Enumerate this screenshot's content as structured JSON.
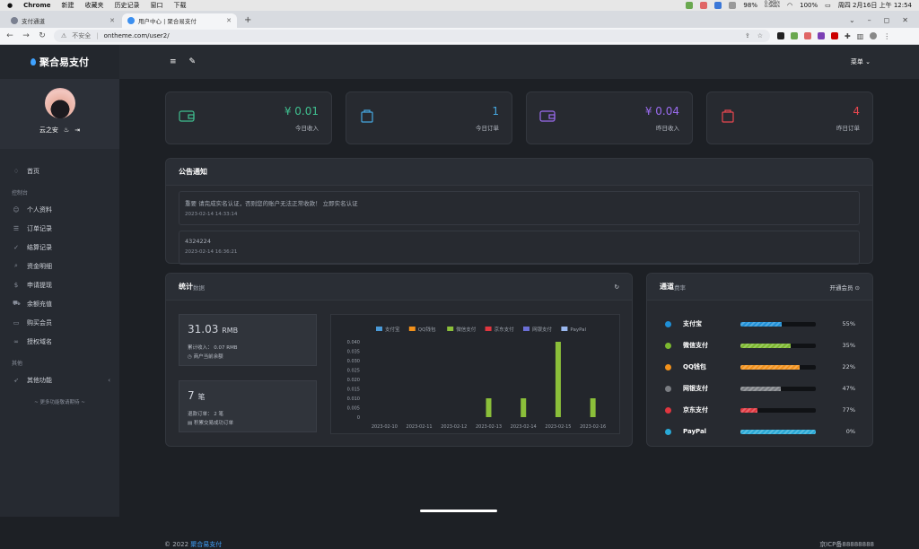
{
  "macbar": {
    "apple": "",
    "items": [
      "Chrome",
      "新建",
      "收藏夹",
      "历史记录",
      "窗口",
      "下载"
    ],
    "battery": "98%",
    "net_up": "0.3KB/s",
    "net_down": "0.5KB/s",
    "zoom": "100%",
    "clock": "周四 2月16日 上午 12:54"
  },
  "tabs": [
    {
      "label": "支付通道"
    },
    {
      "label": "用户中心 | 聚合易支付"
    }
  ],
  "address": {
    "security": "不安全",
    "url": "ontheme.com/user2/"
  },
  "brand": "聚合易支付",
  "user": {
    "name": "云之安"
  },
  "topbar": {
    "menu_label": "菜单"
  },
  "sidebar": {
    "home": "首页",
    "section_console": "控制台",
    "items": [
      {
        "label": "个人资料",
        "icon": "user-icon"
      },
      {
        "label": "订单记录",
        "icon": "list-icon"
      },
      {
        "label": "结算记录",
        "icon": "check-circle-icon"
      },
      {
        "label": "资金明细",
        "icon": "search-icon"
      },
      {
        "label": "申请提现",
        "icon": "dollar-icon"
      },
      {
        "label": "余额充值",
        "icon": "cart-icon"
      },
      {
        "label": "购买会员",
        "icon": "card-icon"
      },
      {
        "label": "授权域名",
        "icon": "link-icon"
      }
    ],
    "section_other": "其他",
    "other": "其他功能",
    "more": "更多功能敬请期待"
  },
  "stats": [
    {
      "value": "¥ 0.01",
      "label": "今日收入",
      "color": "#3fbf8f",
      "icon": "wallet-icon"
    },
    {
      "value": "1",
      "label": "今日订单",
      "color": "#46a8e0",
      "icon": "bag-icon"
    },
    {
      "value": "¥ 0.04",
      "label": "昨日收入",
      "color": "#9b6cf0",
      "icon": "wallet-icon"
    },
    {
      "value": "4",
      "label": "昨日订单",
      "color": "#e8474f",
      "icon": "bag-icon"
    }
  ],
  "announcement": {
    "title": "公告通知",
    "items": [
      {
        "text": "重要 请完成实名认证，否则您的账户无法正常收款！ 立即实名认证",
        "date": "2023-02-14 14:33:14"
      },
      {
        "text": "4324224",
        "date": "2023-02-14 16:36:21"
      }
    ]
  },
  "statistics": {
    "title": "统计",
    "subtitle": "数据",
    "balance": {
      "amount": "31.03",
      "unit": "RMB",
      "line1": "累计收入： 0.07 RMB",
      "line2": "商户当前余额"
    },
    "orders": {
      "amount": "7",
      "unit": "笔",
      "line1": "退款订单： 2 笔",
      "line2": "积累交易成功订单"
    }
  },
  "channels": {
    "title": "通道",
    "subtitle": "费率",
    "action": "开通会员",
    "items": [
      {
        "name": "支付宝",
        "pct": "55%",
        "fill": 0.55,
        "color": "#1f8fd6"
      },
      {
        "name": "微信支付",
        "pct": "35%",
        "fill": 0.67,
        "color": "#7cb82f"
      },
      {
        "name": "QQ钱包",
        "pct": "22%",
        "fill": 0.78,
        "color": "#f2911b"
      },
      {
        "name": "网银支付",
        "pct": "47%",
        "fill": 0.53,
        "color": "#7a7d82"
      },
      {
        "name": "京东支付",
        "pct": "77%",
        "fill": 0.23,
        "color": "#e0363f"
      },
      {
        "name": "PayPal",
        "pct": "0%",
        "fill": 1.0,
        "color": "#29a9d6"
      }
    ]
  },
  "chart_data": {
    "type": "bar",
    "categories": [
      "2023-02-10",
      "2023-02-11",
      "2023-02-12",
      "2023-02-13",
      "2023-02-14",
      "2023-02-15",
      "2023-02-16"
    ],
    "series": [
      {
        "name": "支付宝",
        "color": "#4a9ad8",
        "values": [
          0,
          0,
          0,
          0,
          0,
          0,
          0
        ]
      },
      {
        "name": "QQ钱包",
        "color": "#f2911b",
        "values": [
          0,
          0,
          0,
          0,
          0,
          0,
          0
        ]
      },
      {
        "name": "微信支付",
        "color": "#8bbf3a",
        "values": [
          0,
          0,
          0,
          0.01,
          0.01,
          0.04,
          0.01
        ]
      },
      {
        "name": "京东支付",
        "color": "#e0363f",
        "values": [
          0,
          0,
          0,
          0,
          0,
          0,
          0
        ]
      },
      {
        "name": "网银支付",
        "color": "#6b6fd6",
        "values": [
          0,
          0,
          0,
          0,
          0,
          0,
          0
        ]
      },
      {
        "name": "PayPal",
        "color": "#9ab8f0",
        "values": [
          0,
          0,
          0,
          0,
          0,
          0,
          0
        ]
      }
    ],
    "yticks": [
      "0",
      "0.005",
      "0.010",
      "0.015",
      "0.020",
      "0.025",
      "0.030",
      "0.035",
      "0.040"
    ],
    "ylim": [
      0,
      0.04
    ],
    "grid": false,
    "legend": "top"
  },
  "footer": {
    "copyright": "© 2022",
    "brand": "聚合易支付",
    "icp": "京ICP备88888888"
  }
}
